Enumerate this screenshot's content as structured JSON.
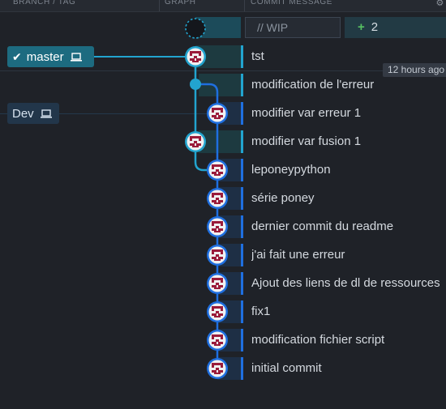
{
  "header": {
    "branch_tag": "BRANCH / TAG",
    "graph": "GRAPH",
    "commit_message": "COMMIT MESSAGE"
  },
  "branches": {
    "master": {
      "label": "master",
      "checked": true,
      "icon": "laptop-icon"
    },
    "dev": {
      "label": "Dev",
      "icon": "laptop-icon"
    }
  },
  "wip": {
    "placeholder": "// WIP",
    "count": "2"
  },
  "tooltip": "12 hours ago",
  "commits": [
    {
      "message": "tst"
    },
    {
      "message": "modification de l'erreur"
    },
    {
      "message": "modifier var erreur 1"
    },
    {
      "message": "modifier var fusion 1"
    },
    {
      "message": "leponeypython"
    },
    {
      "message": "série poney"
    },
    {
      "message": "dernier commit du readme"
    },
    {
      "message": "j'ai fait une erreur"
    },
    {
      "message": "Ajout des liens de dl de ressources"
    },
    {
      "message": "fix1"
    },
    {
      "message": "modification fichier script"
    },
    {
      "message": "initial commit"
    }
  ],
  "colors": {
    "background": "#1f2228",
    "lane_cyan": "#22a4cf",
    "lane_blue": "#1f6fe0",
    "master_badge": "#1d6b80",
    "dev_badge": "#22364a",
    "avatar_red": "#9a1b3a"
  }
}
